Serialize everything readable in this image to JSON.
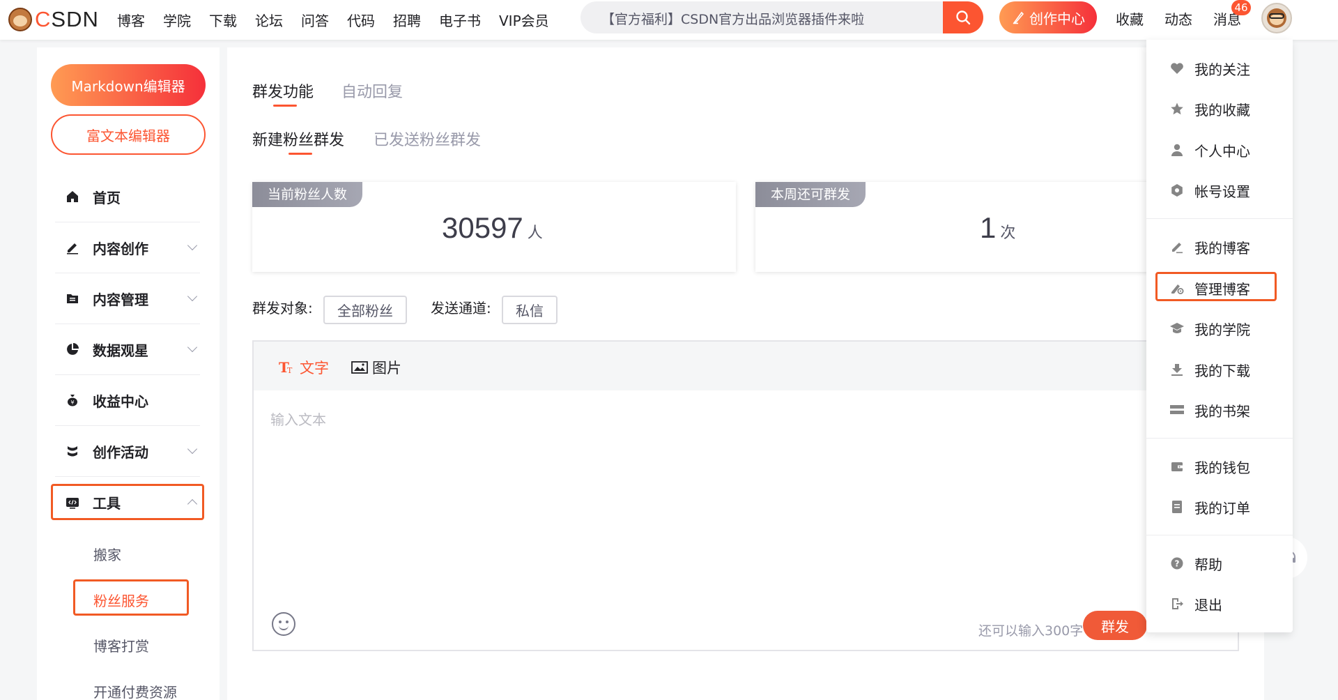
{
  "brand": {
    "logo_text": "CSDN",
    "accent": "#fc5531"
  },
  "nav": [
    "博客",
    "学院",
    "下载",
    "论坛",
    "问答",
    "代码",
    "招聘",
    "电子书",
    "VIP会员"
  ],
  "search": {
    "placeholder": "【官方福利】CSDN官方出品浏览器插件来啦"
  },
  "header": {
    "create_label": "创作中心",
    "favorites": "收藏",
    "activity": "动态",
    "messages": "消息",
    "message_count": "46"
  },
  "sidebar": {
    "markdown_button": "Markdown编辑器",
    "rich_button": "富文本编辑器",
    "items": [
      {
        "label": "首页",
        "icon": "home-icon"
      },
      {
        "label": "内容创作",
        "icon": "edit-icon"
      },
      {
        "label": "内容管理",
        "icon": "folder-icon"
      },
      {
        "label": "数据观星",
        "icon": "pie-chart-icon"
      },
      {
        "label": "收益中心",
        "icon": "money-bag-icon"
      },
      {
        "label": "创作活动",
        "icon": "activity-icon"
      },
      {
        "label": "工具",
        "icon": "tools-icon"
      }
    ],
    "tool_subitems": [
      "搬家",
      "粉丝服务",
      "博客打赏",
      "开通付费资源"
    ]
  },
  "main": {
    "tabs": [
      "群发功能",
      "自动回复"
    ],
    "subtabs": [
      "新建粉丝群发",
      "已发送粉丝群发"
    ],
    "fans_card": {
      "tag": "当前粉丝人数",
      "value": "30597",
      "unit": "人"
    },
    "quota_card": {
      "tag": "本周还可群发",
      "value": "1",
      "unit": "次"
    },
    "target_label": "群发对象:",
    "target_value": "全部粉丝",
    "channel_label": "发送通道:",
    "channel_value": "私信",
    "editor": {
      "text_tool": "文字",
      "image_tool": "图片",
      "placeholder": "输入文本",
      "remaining": "还可以输入300字",
      "send": "群发"
    }
  },
  "dropdown": {
    "groups": [
      [
        {
          "label": "我的关注",
          "icon": "heart-icon"
        },
        {
          "label": "我的收藏",
          "icon": "star-icon"
        },
        {
          "label": "个人中心",
          "icon": "user-icon"
        },
        {
          "label": "帐号设置",
          "icon": "settings-icon"
        }
      ],
      [
        {
          "label": "我的博客",
          "icon": "pen-icon"
        },
        {
          "label": "管理博客",
          "icon": "manage-blog-icon"
        },
        {
          "label": "我的学院",
          "icon": "graduation-cap-icon"
        },
        {
          "label": "我的下载",
          "icon": "download-icon"
        },
        {
          "label": "我的书架",
          "icon": "bookshelf-icon"
        }
      ],
      [
        {
          "label": "我的钱包",
          "icon": "wallet-icon"
        },
        {
          "label": "我的订单",
          "icon": "order-icon"
        }
      ],
      [
        {
          "label": "帮助",
          "icon": "help-icon"
        },
        {
          "label": "退出",
          "icon": "logout-icon"
        }
      ]
    ]
  }
}
